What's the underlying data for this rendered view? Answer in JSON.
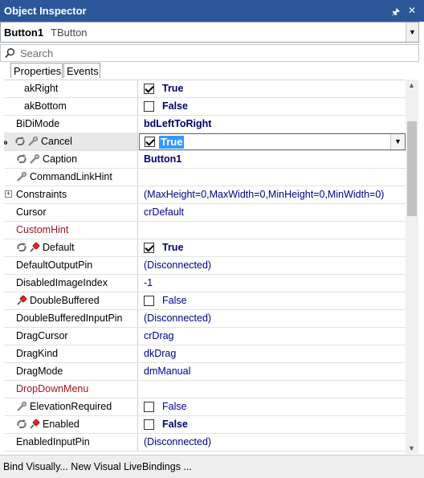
{
  "window": {
    "title": "Object Inspector",
    "pin_icon": "pin-icon",
    "close_icon": "close-icon"
  },
  "selector": {
    "object_name": "Button1",
    "object_class": "TButton"
  },
  "search": {
    "placeholder": "Search"
  },
  "tabs": [
    {
      "label": "Properties",
      "active": true
    },
    {
      "label": "Events",
      "active": false
    }
  ],
  "properties": [
    {
      "name": "akRight",
      "value": "True",
      "style": "bold",
      "checkbox": true,
      "checked": true,
      "name_color": "normal",
      "icons": [],
      "indent": true
    },
    {
      "name": "akBottom",
      "value": "False",
      "style": "bold",
      "checkbox": true,
      "checked": false,
      "name_color": "normal",
      "icons": [],
      "indent": true
    },
    {
      "name": "BiDiMode",
      "value": "bdLeftToRight",
      "style": "bold",
      "checkbox": false,
      "name_color": "normal",
      "icons": []
    },
    {
      "name": "Cancel",
      "value": "True",
      "style": "bold",
      "checkbox": true,
      "checked": true,
      "name_color": "normal",
      "icons": [
        "link-icon",
        "expert-icon"
      ],
      "selected": true
    },
    {
      "name": "Caption",
      "value": "Button1",
      "style": "bold",
      "checkbox": false,
      "name_color": "normal",
      "icons": [
        "link-icon",
        "expert-icon"
      ]
    },
    {
      "name": "CommandLinkHint",
      "value": "",
      "style": "normal",
      "checkbox": false,
      "name_color": "normal",
      "icons": [
        "expert-icon"
      ]
    },
    {
      "name": "Constraints",
      "value": "(MaxHeight=0,MaxWidth=0,MinHeight=0,MinWidth=0)",
      "style": "blue",
      "checkbox": false,
      "name_color": "normal",
      "icons": [],
      "expandable": true
    },
    {
      "name": "Cursor",
      "value": "crDefault",
      "style": "blue",
      "checkbox": false,
      "name_color": "normal",
      "icons": []
    },
    {
      "name": "CustomHint",
      "value": "",
      "style": "normal",
      "checkbox": false,
      "name_color": "red",
      "icons": []
    },
    {
      "name": "Default",
      "value": "True",
      "style": "bold",
      "checkbox": true,
      "checked": true,
      "name_color": "normal",
      "icons": [
        "link-icon",
        "pin-icon"
      ]
    },
    {
      "name": "DefaultOutputPin",
      "value": "(Disconnected)",
      "style": "blue",
      "checkbox": false,
      "name_color": "normal",
      "icons": []
    },
    {
      "name": "DisabledImageIndex",
      "value": "-1",
      "style": "blue",
      "checkbox": false,
      "name_color": "normal",
      "icons": []
    },
    {
      "name": "DoubleBuffered",
      "value": "False",
      "style": "blue",
      "checkbox": true,
      "checked": false,
      "name_color": "normal",
      "icons": [
        "pin-icon"
      ]
    },
    {
      "name": "DoubleBufferedInputPin",
      "value": "(Disconnected)",
      "style": "blue",
      "checkbox": false,
      "name_color": "normal",
      "icons": []
    },
    {
      "name": "DragCursor",
      "value": "crDrag",
      "style": "blue",
      "checkbox": false,
      "name_color": "normal",
      "icons": []
    },
    {
      "name": "DragKind",
      "value": "dkDrag",
      "style": "blue",
      "checkbox": false,
      "name_color": "normal",
      "icons": []
    },
    {
      "name": "DragMode",
      "value": "dmManual",
      "style": "blue",
      "checkbox": false,
      "name_color": "normal",
      "icons": []
    },
    {
      "name": "DropDownMenu",
      "value": "",
      "style": "normal",
      "checkbox": false,
      "name_color": "red",
      "icons": []
    },
    {
      "name": "ElevationRequired",
      "value": "False",
      "style": "blue",
      "checkbox": true,
      "checked": false,
      "name_color": "normal",
      "icons": [
        "expert-icon"
      ]
    },
    {
      "name": "Enabled",
      "value": "False",
      "style": "bold",
      "checkbox": true,
      "checked": false,
      "name_color": "normal",
      "icons": [
        "link-icon",
        "pin-icon"
      ]
    },
    {
      "name": "EnabledInputPin",
      "value": "(Disconnected)",
      "style": "blue",
      "checkbox": false,
      "name_color": "normal",
      "icons": []
    }
  ],
  "footer": {
    "text": "Bind Visually... New Visual LiveBindings ..."
  },
  "colors": {
    "titlebar": "#2b579a",
    "value_blue": "#00008b",
    "name_red": "#a0141e",
    "selection": "#3399ff"
  }
}
